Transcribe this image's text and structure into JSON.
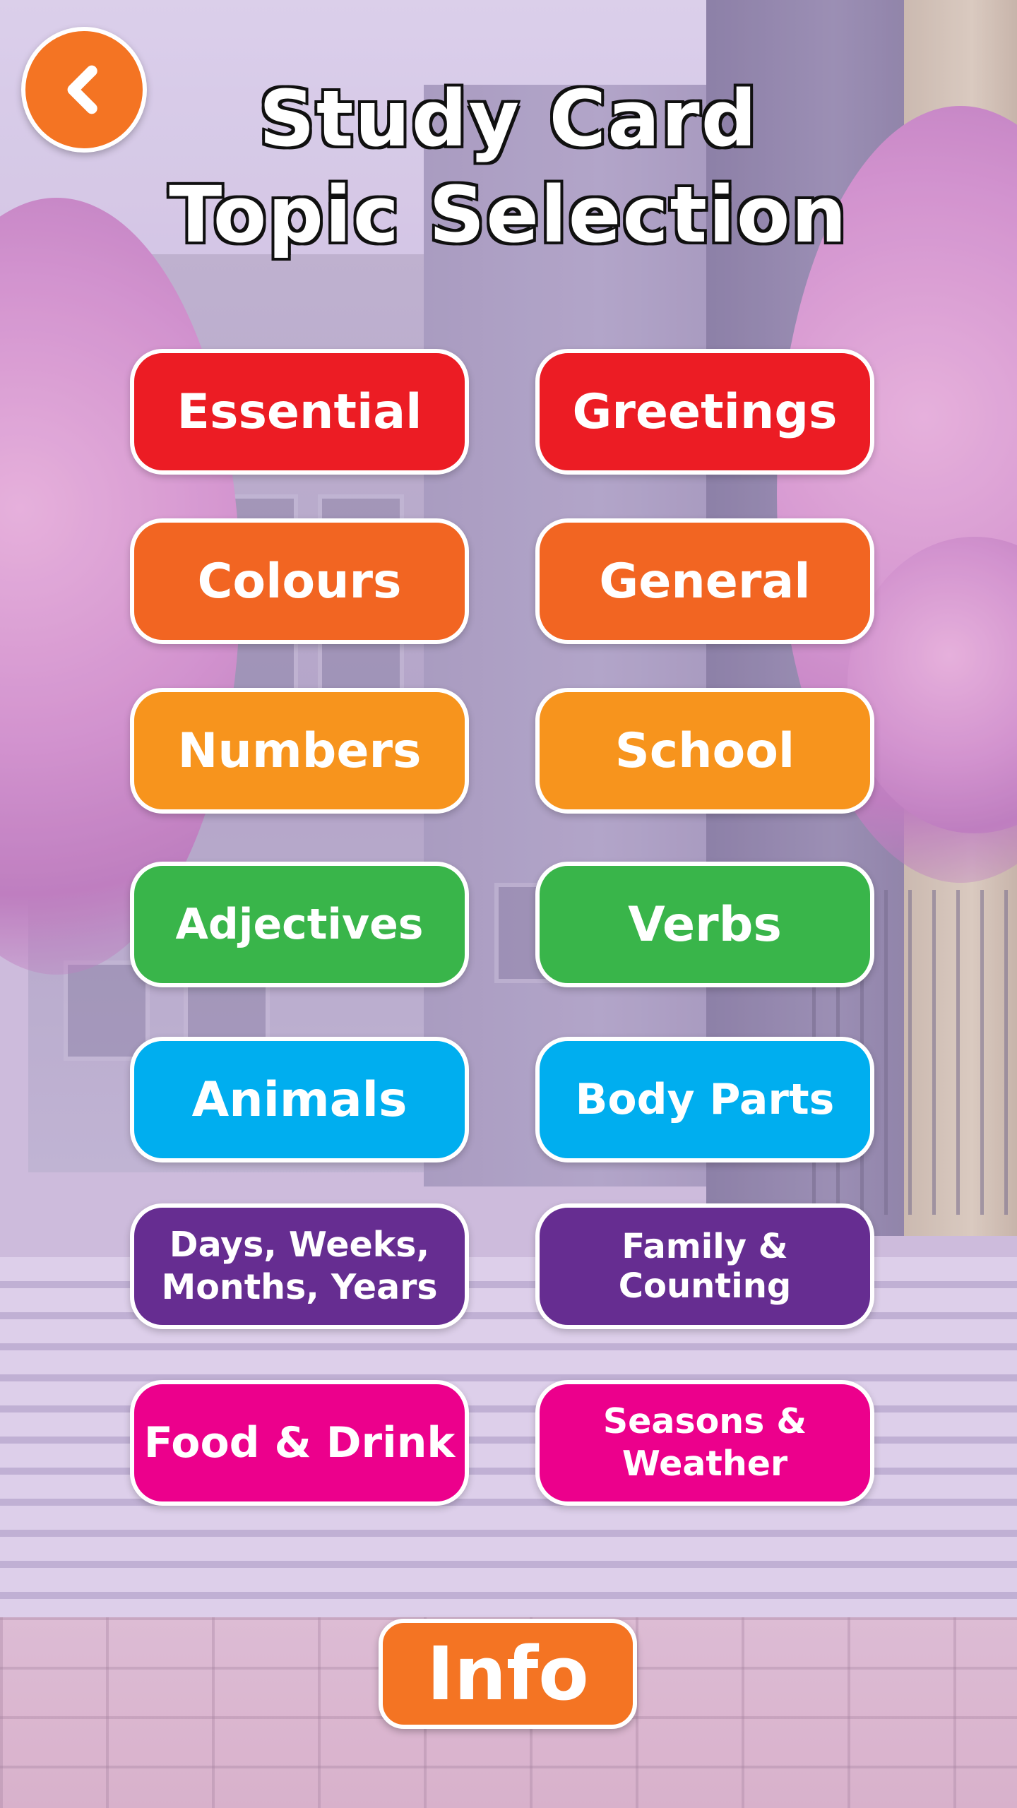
{
  "header": {
    "back_icon": "chevron-left-icon",
    "title_line1": "Study Card",
    "title_line2": "Topic Selection"
  },
  "topics": [
    {
      "label": "Essential",
      "color": "#ec1c24"
    },
    {
      "label": "Greetings",
      "color": "#ec1c24"
    },
    {
      "label": "Colours",
      "color": "#f26522"
    },
    {
      "label": "General",
      "color": "#f26522"
    },
    {
      "label": "Numbers",
      "color": "#f7941d"
    },
    {
      "label": "School",
      "color": "#f7941d"
    },
    {
      "label": "Adjectives",
      "color": "#39b54a"
    },
    {
      "label": "Verbs",
      "color": "#39b54a"
    },
    {
      "label": "Animals",
      "color": "#00aeef"
    },
    {
      "label": "Body Parts",
      "color": "#00aeef"
    },
    {
      "label_line1": "Days, Weeks,",
      "label_line2": "Months, Years",
      "color": "#662d91"
    },
    {
      "label": "Family & Counting",
      "color": "#662d91"
    },
    {
      "label": "Food & Drink",
      "color": "#ec008c"
    },
    {
      "label_line1": "Seasons &",
      "label_line2": "Weather",
      "color": "#ec008c"
    }
  ],
  "footer": {
    "info_label": "Info"
  },
  "colors": {
    "accent": "#f47423",
    "title_outline": "#111111"
  }
}
